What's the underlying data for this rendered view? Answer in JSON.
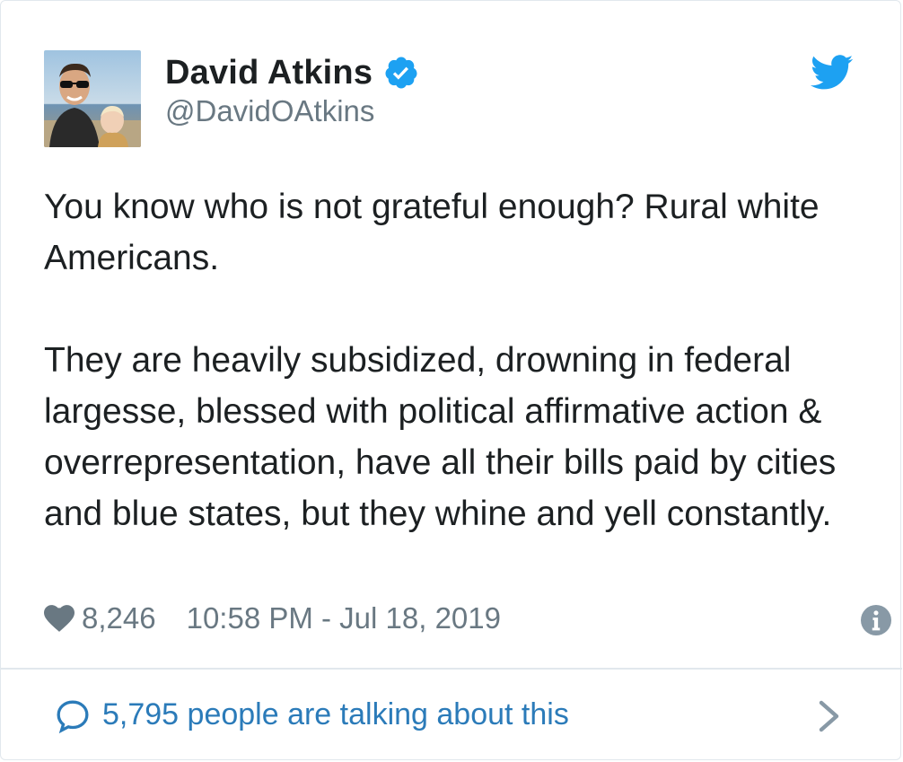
{
  "author": {
    "display_name": "David Atkins",
    "handle": "@DavidOAtkins",
    "verified": true,
    "avatar_icon": "profile-photo"
  },
  "tweet": {
    "paragraphs": [
      "You know who is not grateful enough? Rural white Americans.",
      "They are heavily subsidized, drowning in federal largesse, blessed with political affirmative action & overrepresentation, have all their bills paid by cities and blue states, but they whine and yell constantly."
    ]
  },
  "meta": {
    "like_count": "8,246",
    "timestamp": "10:58 PM - Jul 18, 2019"
  },
  "footer": {
    "talking_text": "5,795 people are talking about this"
  },
  "icons": {
    "brand": "twitter-bird-icon",
    "verified": "verified-badge-icon",
    "like": "heart-icon",
    "info": "info-icon",
    "comment": "comment-bubble-icon",
    "chevron": "chevron-right-icon"
  },
  "colors": {
    "twitter_blue": "#1da1f2",
    "link_blue": "#2b7bb9",
    "secondary_gray": "#697882",
    "text_dark": "#1c2022",
    "border": "#e1e8ed"
  }
}
